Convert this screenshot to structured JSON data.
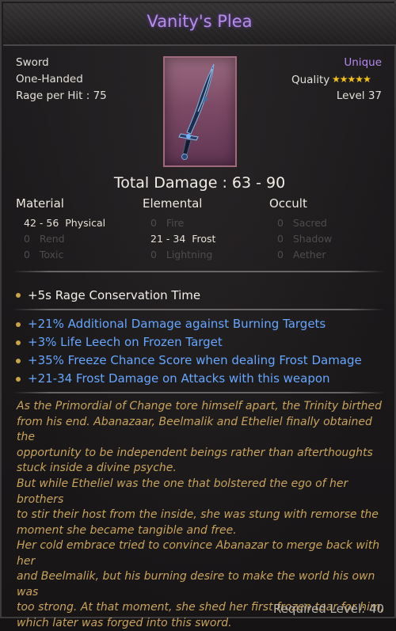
{
  "item": {
    "name": "Vanity's Plea",
    "weapon_type": "Sword",
    "handedness": "One-Handed",
    "rage_per_hit": "Rage per Hit : 75",
    "rarity": "Unique",
    "quality_label": "Quality",
    "quality_stars": 5,
    "level": "Level 37",
    "total_damage": "Total Damage : 63 - 90",
    "required_level": "Required Level: 40"
  },
  "damage": {
    "headers": [
      "Material",
      "Elemental",
      "Occult"
    ],
    "material": [
      {
        "value": "42 - 56",
        "label": "Physical",
        "active": true
      },
      {
        "value": "0",
        "label": "Rend",
        "active": false
      },
      {
        "value": "0",
        "label": "Toxic",
        "active": false
      }
    ],
    "elemental": [
      {
        "value": "0",
        "label": "Fire",
        "active": false
      },
      {
        "value": "21 - 34",
        "label": "Frost",
        "active": true
      },
      {
        "value": "0",
        "label": "Lightning",
        "active": false
      }
    ],
    "occult": [
      {
        "value": "0",
        "label": "Sacred",
        "active": false
      },
      {
        "value": "0",
        "label": "Shadow",
        "active": false
      },
      {
        "value": "0",
        "label": "Aether",
        "active": false
      }
    ]
  },
  "affixes": {
    "base": [
      "+5s Rage Conservation Time"
    ],
    "magic": [
      "+21% Additional Damage against Burning Targets",
      "+3% Life Leech on Frozen Target",
      "+35% Freeze Chance Score when dealing Frost Damage",
      "+21-34 Frost Damage on Attacks with this weapon"
    ]
  },
  "lore": {
    "p1": [
      "As the Primordial of Change tore himself apart, the Trinity birthed",
      "from his end. Abanazaar, Beelmalik and Etheliel finally obtained the",
      "opportunity to be independent beings rather than afterthoughts",
      "stuck inside a divine psyche."
    ],
    "p2": [
      "But while Etheliel was the one that bolstered the ego of her brothers",
      "to stir their host from the inside, she was stung with remorse the",
      "moment she became tangible and free."
    ],
    "p3": [
      "Her cold embrace tried to convince Abanazar to merge back with her",
      "and Beelmalik, but his burning desire to make the world his own was",
      "too strong.  At that moment, she shed her first frozen tear for him,",
      "which later was forged into this sword."
    ]
  },
  "colors": {
    "title": "#b58de8",
    "unique": "#b688f0",
    "star": "#f2c21b",
    "affix_magic": "#66a6ff",
    "lore": "#c9a35c",
    "inactive": "#4f4c4d"
  }
}
